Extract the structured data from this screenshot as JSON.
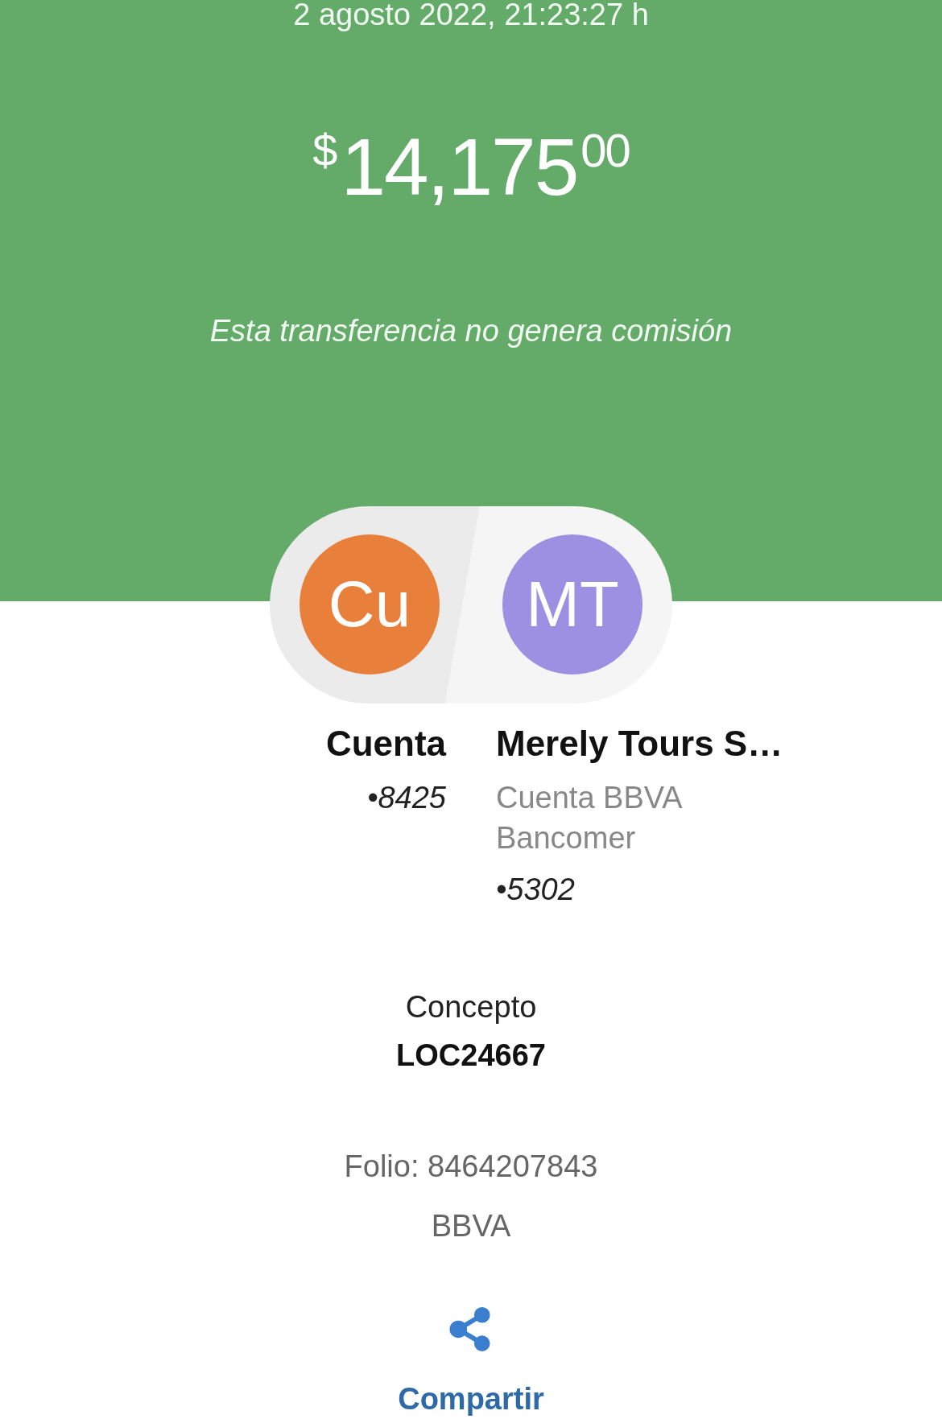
{
  "date": "2 agosto 2022, 21:23:27 h",
  "amount": {
    "currency": "$",
    "integer": "14,175",
    "cents": "00"
  },
  "commission_note": "Esta transferencia no genera comisión",
  "parties": [
    {
      "initials": "Cu",
      "color": "#e8803c",
      "name": "Cuenta",
      "account": "•8425"
    },
    {
      "initials": "MT",
      "color": "#9d8fe2",
      "name": "Merely Tours S…",
      "bank": "Cuenta BBVA Bancomer",
      "account": "•5302"
    }
  ],
  "concept": {
    "label": "Concepto",
    "value": "LOC24667"
  },
  "folio": "Folio: 8464207843",
  "bank": "BBVA",
  "share": {
    "label": "Compartir"
  }
}
